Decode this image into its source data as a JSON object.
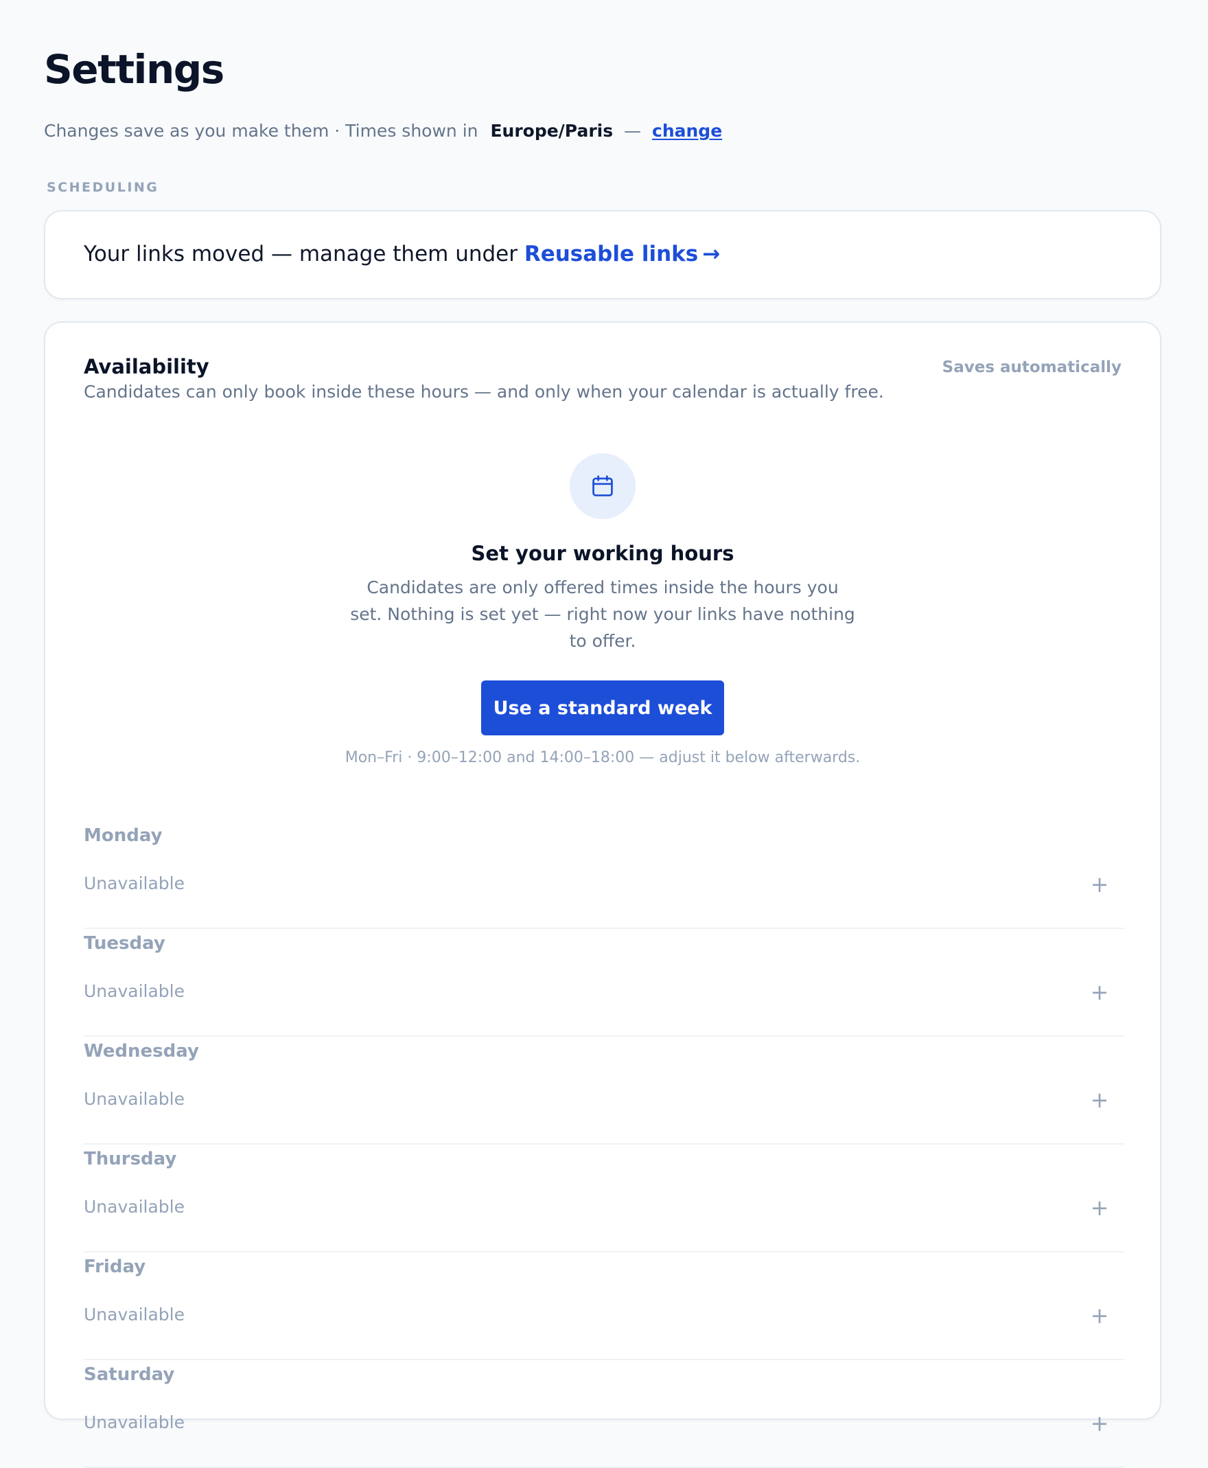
{
  "header": {
    "title": "Settings",
    "subtitle_prefix": "Changes save as you make them · Times shown in",
    "timezone": "Europe/Paris",
    "separator": "—",
    "change_link": "change"
  },
  "section_label": "SCHEDULING",
  "notice": {
    "text": "Your links moved — manage them under ",
    "link_label": "Reusable links",
    "arrow": "→"
  },
  "availability": {
    "title": "Availability",
    "status": "Saves automatically",
    "description": "Candidates can only book inside these hours — and only when your calendar is actually free.",
    "empty_state": {
      "icon": "calendar-icon",
      "title": "Set your working hours",
      "body": "Candidates are only offered times inside the hours you set. Nothing is set yet — right now your links have nothing to offer.",
      "button_label": "Use a standard week",
      "hint": "Mon–Fri · 9:00–12:00 and 14:00–18:00 — adjust it below afterwards."
    },
    "days": [
      {
        "name": "Monday",
        "status": "Unavailable",
        "add": "+"
      },
      {
        "name": "Tuesday",
        "status": "Unavailable",
        "add": "+"
      },
      {
        "name": "Wednesday",
        "status": "Unavailable",
        "add": "+"
      },
      {
        "name": "Thursday",
        "status": "Unavailable",
        "add": "+"
      },
      {
        "name": "Friday",
        "status": "Unavailable",
        "add": "+"
      },
      {
        "name": "Saturday",
        "status": "Unavailable",
        "add": "+"
      }
    ]
  },
  "colors": {
    "accent": "#1d4ed8",
    "background": "#f8fafc",
    "muted_text": "#94a3b8",
    "body_text": "#64748b",
    "heading_text": "#0b1428"
  }
}
